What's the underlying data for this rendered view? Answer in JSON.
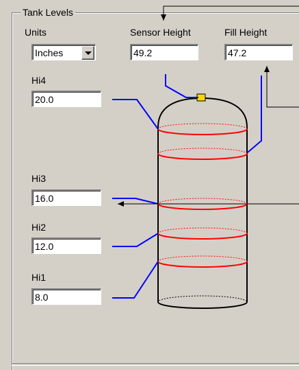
{
  "group": {
    "title": "Tank Levels"
  },
  "units": {
    "label": "Units",
    "value": "Inches"
  },
  "sensor_height": {
    "label": "Sensor Height",
    "value": "49.2"
  },
  "fill_height": {
    "label": "Fill Height",
    "value": "47.2"
  },
  "levels": [
    {
      "label": "Hi4",
      "value": "20.0"
    },
    {
      "label": "Hi3",
      "value": "16.0"
    },
    {
      "label": "Hi2",
      "value": "12.0"
    },
    {
      "label": "Hi1",
      "value": "8.0"
    }
  ],
  "colors": {
    "leader": "#0000ff",
    "level_ring": "#ff0000",
    "sensor": "#ffd700",
    "panel": "#d4d0c8"
  }
}
